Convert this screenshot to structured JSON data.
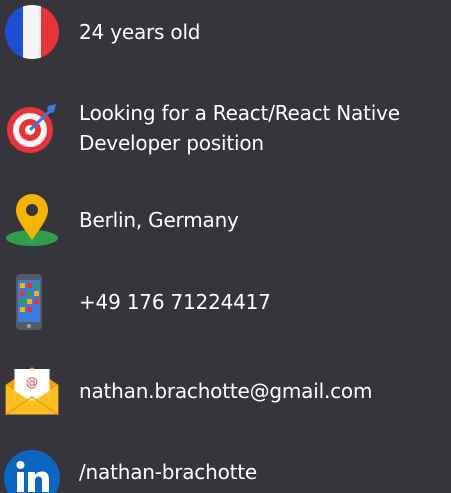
{
  "profile": {
    "items": [
      {
        "key": "age",
        "icon": "france-flag-icon",
        "text": "24 years old"
      },
      {
        "key": "goal",
        "icon": "target-icon",
        "text_line1": "Looking for a React/React Native",
        "text_line2": "Developer position"
      },
      {
        "key": "location",
        "icon": "location-pin-icon",
        "text": "Berlin, Germany"
      },
      {
        "key": "phone",
        "icon": "smartphone-icon",
        "text": "+49 176 71224417"
      },
      {
        "key": "email",
        "icon": "email-envelope-icon",
        "text": "nathan.brachotte@gmail.com"
      },
      {
        "key": "linkedin",
        "icon": "linkedin-icon",
        "text": "/nathan-brachotte"
      }
    ]
  },
  "colors": {
    "background": "#35353b",
    "text": "#ffffff",
    "flag_blue": "#1f4fd1",
    "flag_red": "#e8323c",
    "pin_yellow": "#f4b400",
    "pin_green": "#2e9e4b",
    "linkedin_blue": "#0a66c2",
    "envelope_yellow": "#fbbf24"
  }
}
